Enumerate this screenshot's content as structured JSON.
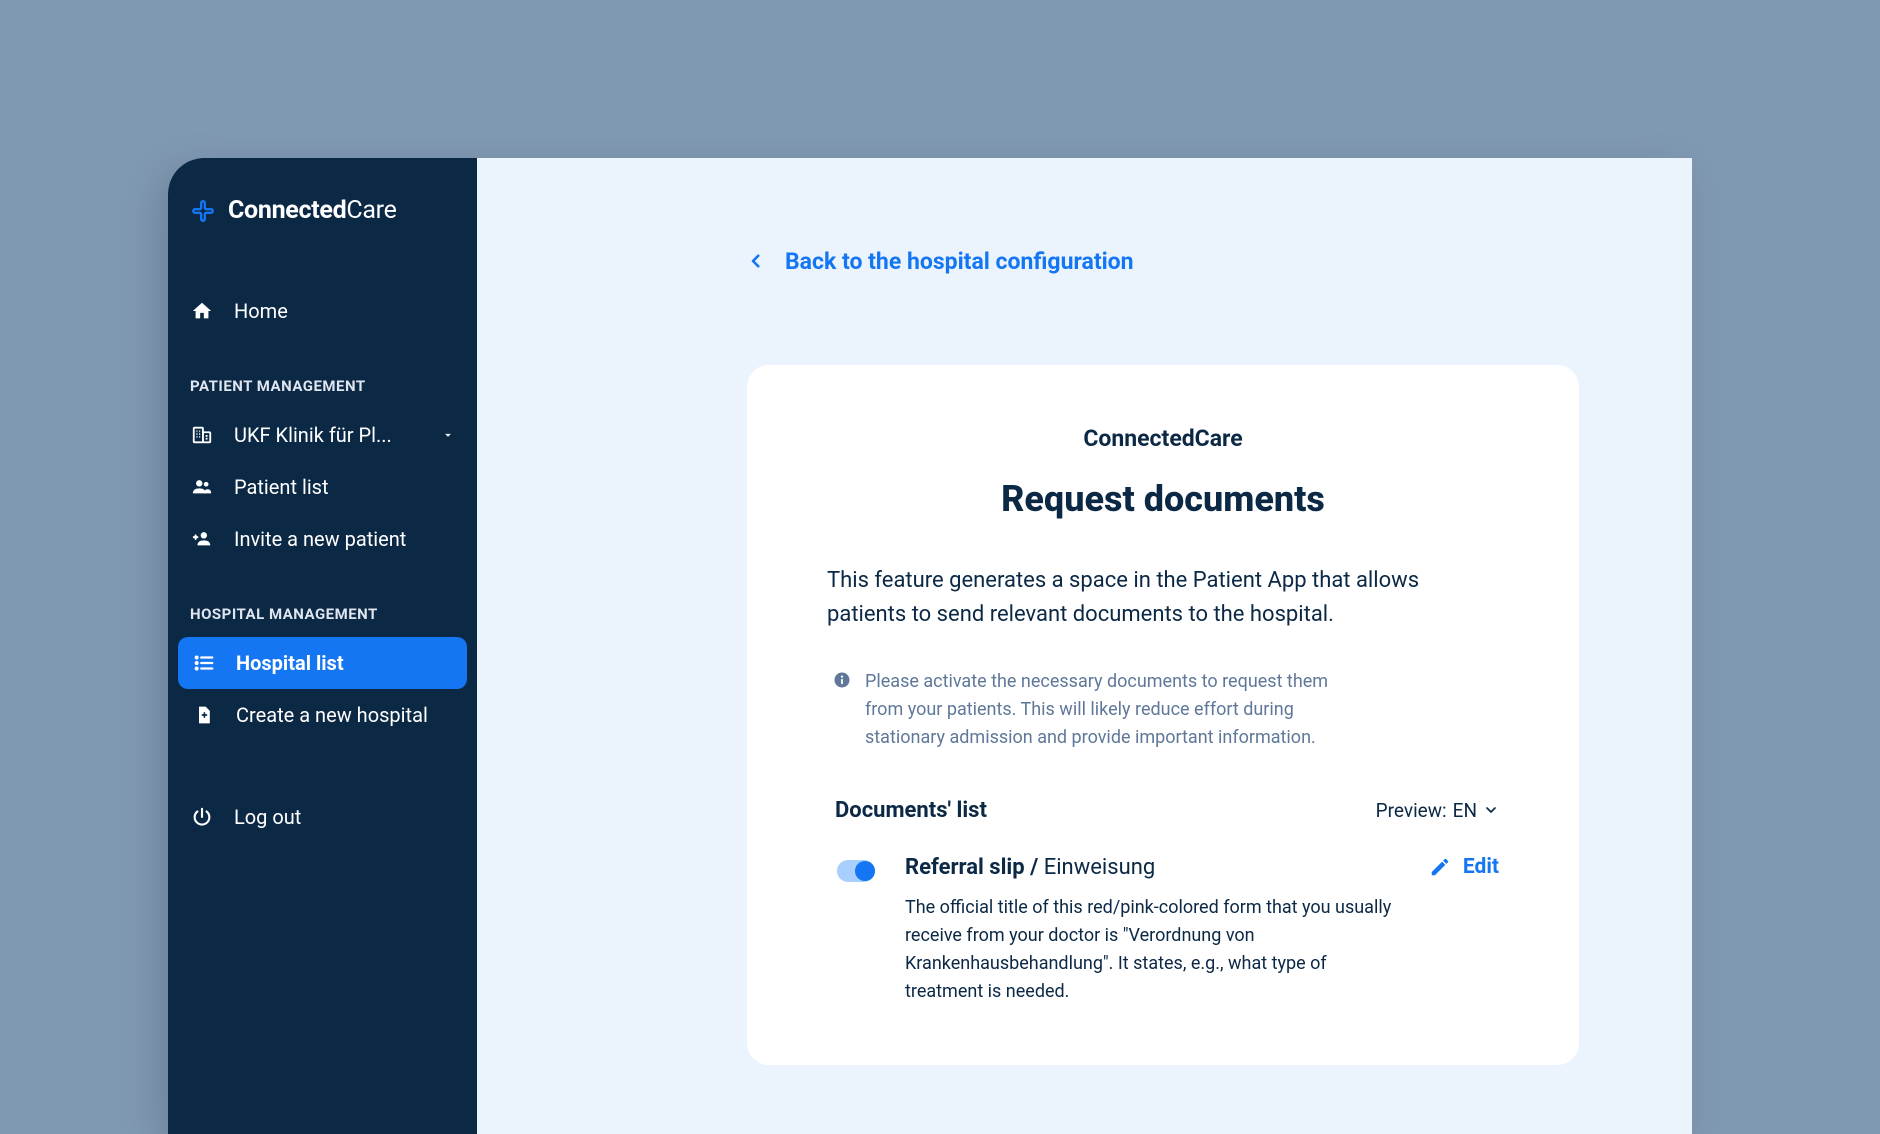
{
  "brand": {
    "prefix": "Connected",
    "suffix": "Care"
  },
  "sidebar": {
    "home": "Home",
    "sections": {
      "patient": {
        "label": "PATIENT MANAGEMENT",
        "clinic": "UKF Klinik für Pl...",
        "patient_list": "Patient list",
        "invite": "Invite a new patient"
      },
      "hospital": {
        "label": "HOSPITAL MANAGEMENT",
        "list": "Hospital list",
        "create": "Create a new hospital"
      }
    },
    "logout": "Log out"
  },
  "main": {
    "back_link": "Back to the hospital configuration",
    "card": {
      "brand": "ConnectedCare",
      "title": "Request documents",
      "description": "This feature generates a space in the Patient App that allows patients to send relevant documents to the hospital.",
      "info": "Please activate the necessary documents to request them from your patients. This will likely reduce effort during stationary admission and provide important information.",
      "list_title": "Documents' list",
      "preview_label": "Preview:",
      "preview_lang": "EN",
      "documents": [
        {
          "enabled": true,
          "title_strong": "Referral slip /",
          "title_rest": " Einweisung",
          "desc": "The official title of this red/pink-colored form that you usually receive from your doctor is \"Verordnung von Krankenhausbehandlung\". It states, e.g., what type of treatment is needed.",
          "edit_label": "Edit"
        }
      ]
    }
  }
}
